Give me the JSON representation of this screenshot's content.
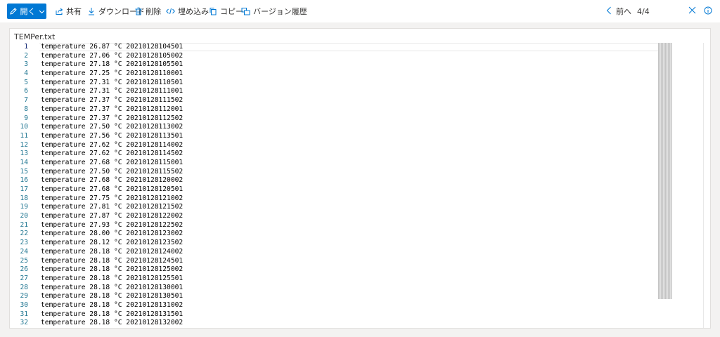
{
  "toolbar": {
    "open_label": "開く",
    "share_label": "共有",
    "download_label": "ダウンロード",
    "delete_label": "削除",
    "embed_label": "埋め込み",
    "copy_label": "コピー",
    "version_history_label": "バージョン履歴",
    "prev_label": "前へ",
    "page_counter": "4/4",
    "icons": [
      "pencil-icon",
      "chevron-down-icon",
      "share-icon",
      "download-icon",
      "trash-icon",
      "embed-icon",
      "copy-icon",
      "version-history-icon",
      "chevron-left-icon",
      "close-icon",
      "info-icon"
    ]
  },
  "file": {
    "name": "TEMPer.txt"
  },
  "lines": [
    {
      "n": "1",
      "text": "temperature 26.87 °C 20210128104501"
    },
    {
      "n": "2",
      "text": "temperature 27.06 °C 20210128105002"
    },
    {
      "n": "3",
      "text": "temperature 27.18 °C 20210128105501"
    },
    {
      "n": "4",
      "text": "temperature 27.25 °C 20210128110001"
    },
    {
      "n": "5",
      "text": "temperature 27.31 °C 20210128110501"
    },
    {
      "n": "6",
      "text": "temperature 27.31 °C 20210128111001"
    },
    {
      "n": "7",
      "text": "temperature 27.37 °C 20210128111502"
    },
    {
      "n": "8",
      "text": "temperature 27.37 °C 20210128112001"
    },
    {
      "n": "9",
      "text": "temperature 27.37 °C 20210128112502"
    },
    {
      "n": "10",
      "text": "temperature 27.50 °C 20210128113002"
    },
    {
      "n": "11",
      "text": "temperature 27.56 °C 20210128113501"
    },
    {
      "n": "12",
      "text": "temperature 27.62 °C 20210128114002"
    },
    {
      "n": "13",
      "text": "temperature 27.62 °C 20210128114502"
    },
    {
      "n": "14",
      "text": "temperature 27.68 °C 20210128115001"
    },
    {
      "n": "15",
      "text": "temperature 27.50 °C 20210128115502"
    },
    {
      "n": "16",
      "text": "temperature 27.68 °C 20210128120002"
    },
    {
      "n": "17",
      "text": "temperature 27.68 °C 20210128120501"
    },
    {
      "n": "18",
      "text": "temperature 27.75 °C 20210128121002"
    },
    {
      "n": "19",
      "text": "temperature 27.81 °C 20210128121502"
    },
    {
      "n": "20",
      "text": "temperature 27.87 °C 20210128122002"
    },
    {
      "n": "21",
      "text": "temperature 27.93 °C 20210128122502"
    },
    {
      "n": "22",
      "text": "temperature 28.00 °C 20210128123002"
    },
    {
      "n": "23",
      "text": "temperature 28.12 °C 20210128123502"
    },
    {
      "n": "24",
      "text": "temperature 28.18 °C 20210128124002"
    },
    {
      "n": "25",
      "text": "temperature 28.18 °C 20210128124501"
    },
    {
      "n": "26",
      "text": "temperature 28.18 °C 20210128125002"
    },
    {
      "n": "27",
      "text": "temperature 28.18 °C 20210128125501"
    },
    {
      "n": "28",
      "text": "temperature 28.18 °C 20210128130001"
    },
    {
      "n": "29",
      "text": "temperature 28.18 °C 20210128130501"
    },
    {
      "n": "30",
      "text": "temperature 28.18 °C 20210128131002"
    },
    {
      "n": "31",
      "text": "temperature 28.18 °C 20210128131501"
    },
    {
      "n": "32",
      "text": "temperature 28.18 °C 20210128132002"
    }
  ],
  "colors": {
    "accent": "#0078d4",
    "line_number": "#237893",
    "active_line_number": "#0b216f",
    "background": "#f3f2f1"
  }
}
